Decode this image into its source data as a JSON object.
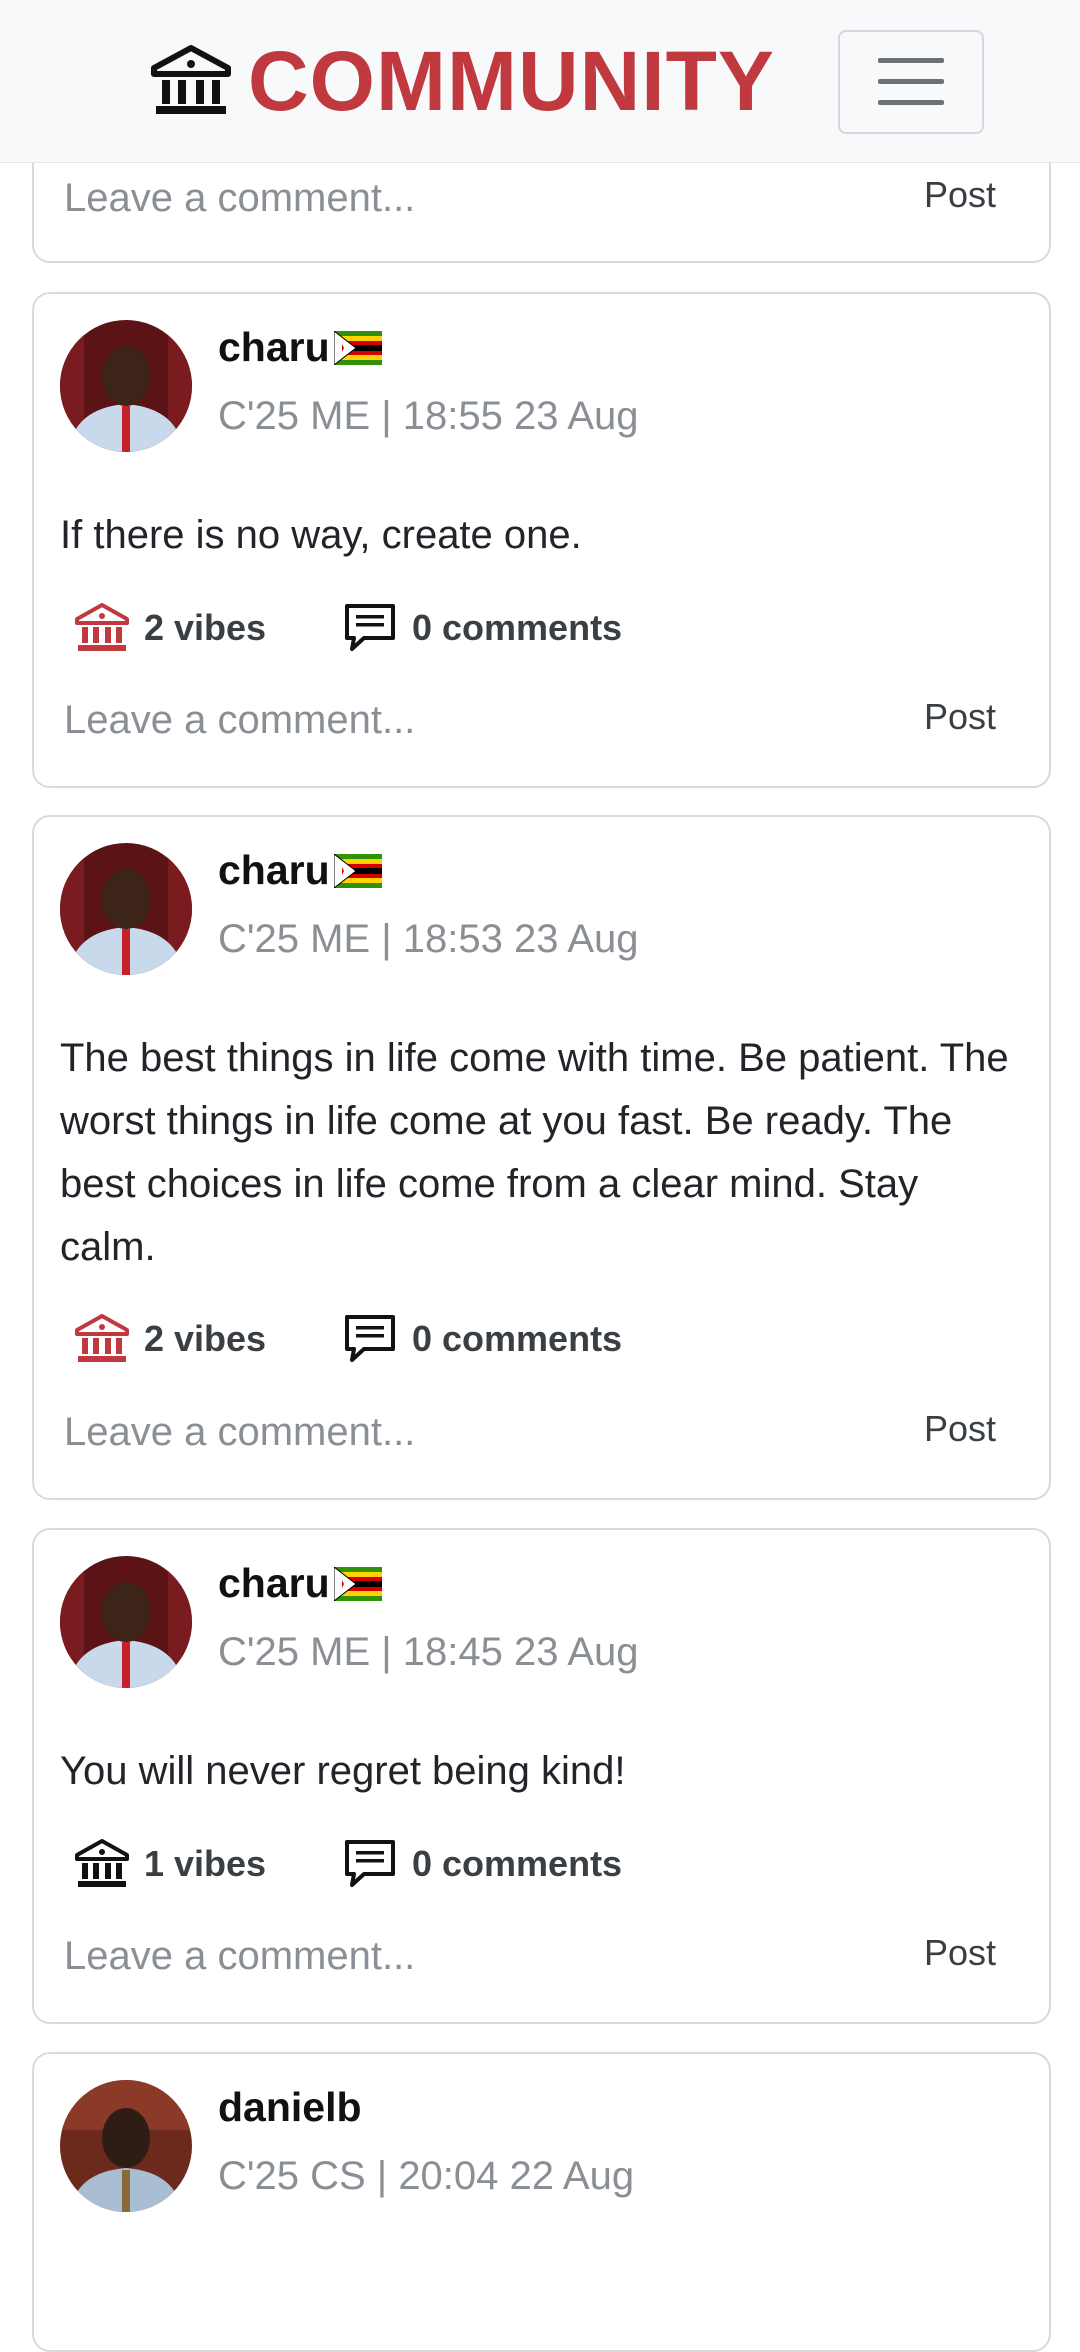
{
  "header": {
    "brand": "COMMUNITY",
    "brand_icon": "institution-icon",
    "menu_icon": "hamburger-menu-icon",
    "brand_color": "#c0393f"
  },
  "comment_placeholder": "Leave a comment...",
  "post_label": "Post",
  "posts": [
    {
      "username": "",
      "meta": "",
      "text": "",
      "vibes": "",
      "comments": ""
    },
    {
      "username": "charu",
      "meta": "C'25 ME | 18:55 23 Aug",
      "text": "If there is no way, create one.",
      "vibes": "2 vibes",
      "comments": "0 comments",
      "vibed": true
    },
    {
      "username": "charu",
      "meta": "C'25 ME | 18:53 23 Aug",
      "text": "The best things in life come with time. Be patient. The worst things in life come at you fast. Be ready. The best choices in life come from a clear mind. Stay calm.",
      "vibes": "2 vibes",
      "comments": "0 comments",
      "vibed": true
    },
    {
      "username": "charu",
      "meta": "C'25 ME | 18:45 23 Aug",
      "text": "You will never regret being kind!",
      "vibes": "1 vibes",
      "comments": "0 comments",
      "vibed": false
    },
    {
      "username": "danielb",
      "meta": "C'25 CS | 20:04 22 Aug"
    }
  ],
  "colors": {
    "vibe_active": "#c0393f",
    "vibe_inactive": "#111111"
  }
}
